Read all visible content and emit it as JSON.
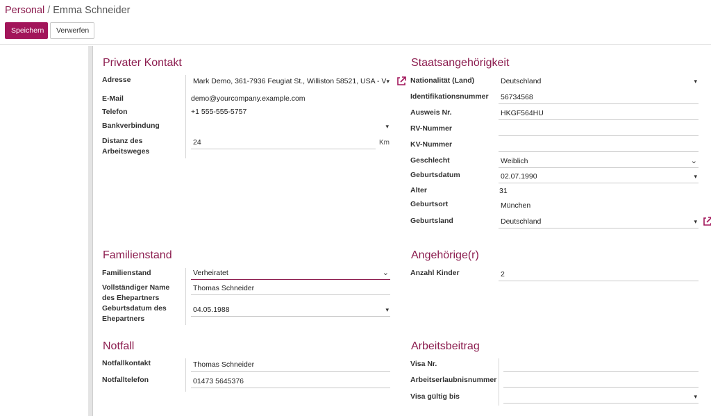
{
  "breadcrumb": {
    "root": "Personal",
    "separator": "/",
    "current": "Emma Schneider"
  },
  "toolbar": {
    "save_label": "Speichern",
    "discard_label": "Verwerfen"
  },
  "private_contact": {
    "title": "Privater Kontakt",
    "address_label": "Adresse",
    "address_value": "Mark Demo, 361-7936 Feugiat St., Williston 58521, USA - V",
    "email_label": "E-Mail",
    "email_value": "demo@yourcompany.example.com",
    "phone_label": "Telefon",
    "phone_value": "+1 555-555-5757",
    "bank_label": "Bankverbindung",
    "bank_value": "",
    "distance_label": "Distanz des Arbeitsweges",
    "distance_value": "24",
    "distance_unit": "Km"
  },
  "citizenship": {
    "title": "Staatsangehörigkeit",
    "nationality_label": "Nationalität (Land)",
    "nationality_value": "Deutschland",
    "id_label": "Identifikationsnummer",
    "id_value": "56734568",
    "passport_label": "Ausweis Nr.",
    "passport_value": "HKGF564HU",
    "rv_label": "RV-Nummer",
    "rv_value": "",
    "kv_label": "KV-Nummer",
    "kv_value": "",
    "gender_label": "Geschlecht",
    "gender_value": "Weiblich",
    "birthday_label": "Geburtsdatum",
    "birthday_value": "02.07.1990",
    "age_label": "Alter",
    "age_value": "31",
    "birthplace_label": "Geburtsort",
    "birthplace_value": "München",
    "birthcountry_label": "Geburtsland",
    "birthcountry_value": "Deutschland"
  },
  "marital": {
    "title": "Familienstand",
    "status_label": "Familienstand",
    "status_value": "Verheiratet",
    "spouse_name_label": "Vollständiger Name des Ehepartners",
    "spouse_name_value": "Thomas Schneider",
    "spouse_birthday_label": "Geburtsdatum des Ehepartners",
    "spouse_birthday_value": "04.05.1988"
  },
  "dependants": {
    "title": "Angehörige(r)",
    "children_label": "Anzahl Kinder",
    "children_value": "2"
  },
  "emergency": {
    "title": "Notfall",
    "contact_label": "Notfallkontakt",
    "contact_value": "Thomas Schneider",
    "phone_label": "Notfalltelefon",
    "phone_value": "01473 5645376"
  },
  "work_permit": {
    "title": "Arbeitsbeitrag",
    "visa_label": "Visa Nr.",
    "visa_value": "",
    "permit_label": "Arbeitserlaubnisnummer",
    "permit_value": "",
    "visa_expire_label": "Visa gültig bis",
    "visa_expire_value": ""
  },
  "icons": {
    "caret": "caret-down-icon",
    "chevron": "chevron-down-icon",
    "external_link": "external-link-icon"
  },
  "colors": {
    "accent": "#a2155a",
    "title": "#8c1d4f"
  }
}
